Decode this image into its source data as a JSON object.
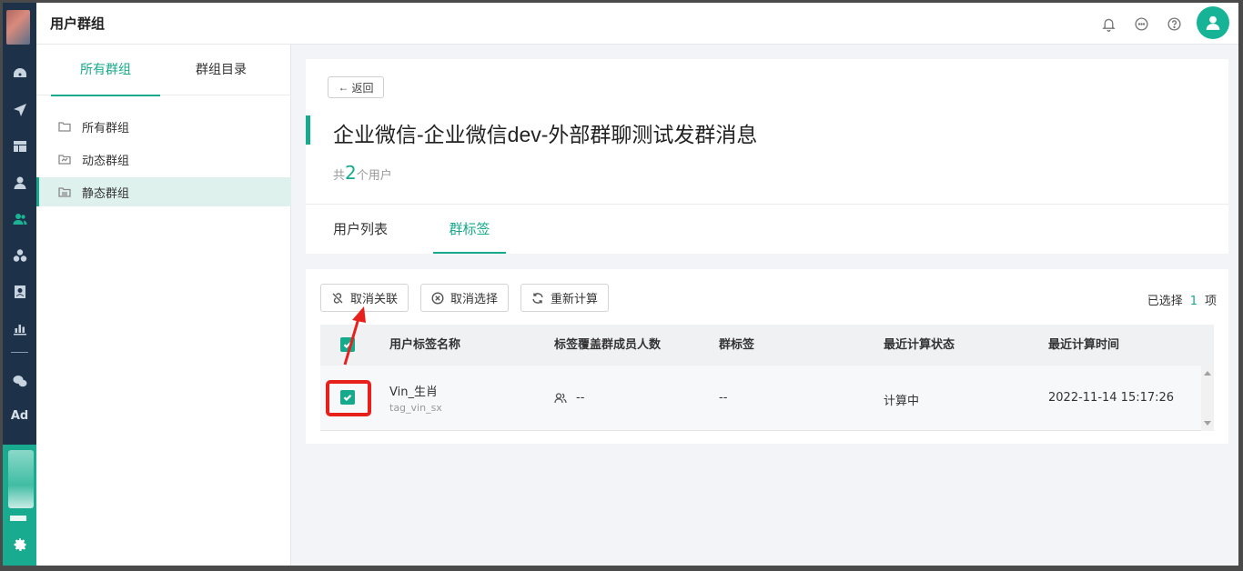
{
  "header": {
    "title": "用户群组"
  },
  "sidebar": {
    "tabs": [
      {
        "label": "所有群组"
      },
      {
        "label": "群组目录"
      }
    ],
    "items": [
      {
        "label": "所有群组"
      },
      {
        "label": "动态群组"
      },
      {
        "label": "静态群组"
      }
    ]
  },
  "rail": {
    "ad_label": "Ad"
  },
  "main": {
    "back_label": "返回",
    "group_title": "企业微信-企业微信dev-外部群聊测试发群消息",
    "count_prefix": "共",
    "count_value": "2",
    "count_suffix": "个用户",
    "tabs": [
      {
        "label": "用户列表"
      },
      {
        "label": "群标签"
      }
    ],
    "toolbar": {
      "unlink_label": "取消关联",
      "deselect_label": "取消选择",
      "recalc_label": "重新计算"
    },
    "selected": {
      "prefix": "已选择",
      "count": "1",
      "suffix": "项"
    },
    "table": {
      "columns": [
        "用户标签名称",
        "标签覆盖群成员人数",
        "群标签",
        "最近计算状态",
        "最近计算时间"
      ],
      "rows": [
        {
          "name": "Vin_生肖",
          "code": "tag_vin_sx",
          "members": "--",
          "group_tag": "--",
          "status": "计算中",
          "time": "2022-11-14 15:17:26"
        }
      ]
    }
  },
  "colors": {
    "accent": "#16a98c",
    "rail_bg": "#1d3149",
    "annotation": "#e8201c"
  }
}
